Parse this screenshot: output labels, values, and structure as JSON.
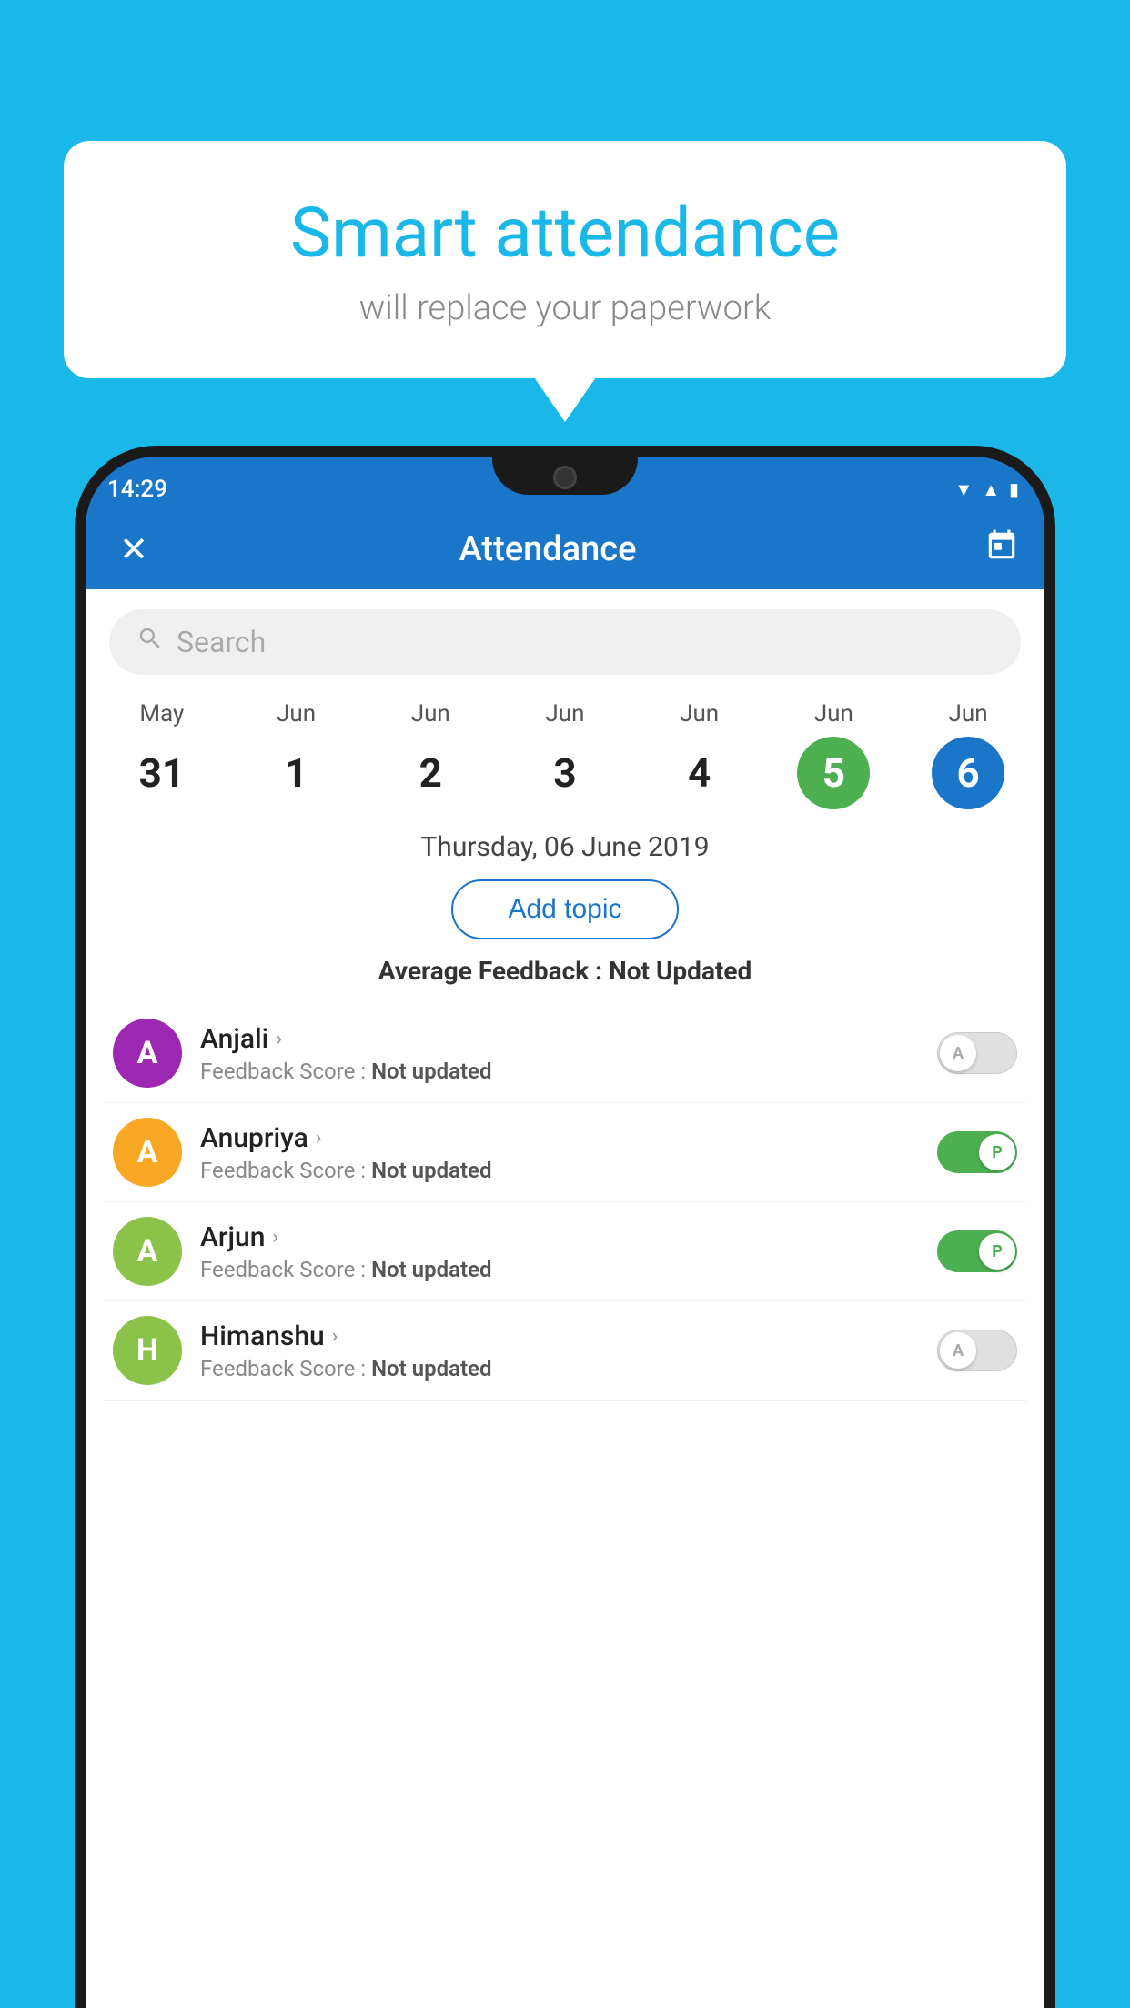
{
  "background_color": "#1ab8e8",
  "bubble": {
    "title": "Smart attendance",
    "subtitle": "will replace your paperwork"
  },
  "status_bar": {
    "time": "14:29",
    "signal_icon": "▲",
    "wifi_icon": "▼"
  },
  "app_bar": {
    "title": "Attendance",
    "close_icon": "✕",
    "calendar_icon": "📅"
  },
  "search": {
    "placeholder": "Search"
  },
  "calendar": {
    "days": [
      {
        "month": "May",
        "date": "31",
        "state": "normal"
      },
      {
        "month": "Jun",
        "date": "1",
        "state": "normal"
      },
      {
        "month": "Jun",
        "date": "2",
        "state": "normal"
      },
      {
        "month": "Jun",
        "date": "3",
        "state": "normal"
      },
      {
        "month": "Jun",
        "date": "4",
        "state": "normal"
      },
      {
        "month": "Jun",
        "date": "5",
        "state": "today"
      },
      {
        "month": "Jun",
        "date": "6",
        "state": "selected"
      }
    ]
  },
  "selected_date": "Thursday, 06 June 2019",
  "add_topic_label": "Add topic",
  "avg_feedback_label": "Average Feedback :",
  "avg_feedback_value": "Not Updated",
  "students": [
    {
      "name": "Anjali",
      "avatar_letter": "A",
      "avatar_color": "#9c27b0",
      "feedback_label": "Feedback Score :",
      "feedback_value": "Not updated",
      "toggle_state": "off",
      "toggle_label": "A"
    },
    {
      "name": "Anupriya",
      "avatar_letter": "A",
      "avatar_color": "#f9a825",
      "feedback_label": "Feedback Score :",
      "feedback_value": "Not updated",
      "toggle_state": "on",
      "toggle_label": "P"
    },
    {
      "name": "Arjun",
      "avatar_letter": "A",
      "avatar_color": "#8bc34a",
      "feedback_label": "Feedback Score :",
      "feedback_value": "Not updated",
      "toggle_state": "on",
      "toggle_label": "P"
    },
    {
      "name": "Himanshu",
      "avatar_letter": "H",
      "avatar_color": "#8bc34a",
      "feedback_label": "Feedback Score :",
      "feedback_value": "Not updated",
      "toggle_state": "off",
      "toggle_label": "A"
    }
  ]
}
